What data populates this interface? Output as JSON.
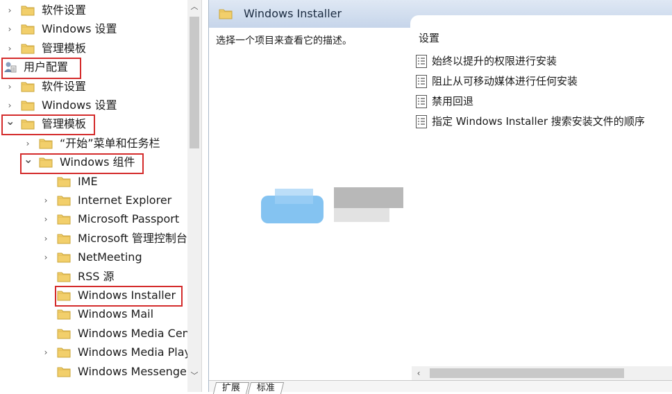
{
  "tree": {
    "items": [
      {
        "label": "软件设置",
        "expander": "collapsed",
        "icon": "folder-icon"
      },
      {
        "label": "Windows 设置",
        "expander": "collapsed",
        "icon": "folder-icon"
      },
      {
        "label": "管理模板",
        "expander": "collapsed",
        "icon": "folder-icon"
      },
      {
        "label": "用户配置",
        "expander": "none",
        "icon": "user-config-icon"
      },
      {
        "label": "软件设置",
        "expander": "collapsed",
        "icon": "folder-icon"
      },
      {
        "label": "Windows 设置",
        "expander": "collapsed",
        "icon": "folder-icon"
      },
      {
        "label": "管理模板",
        "expander": "expanded",
        "icon": "folder-icon"
      },
      {
        "label": "“开始”菜单和任务栏",
        "expander": "collapsed",
        "icon": "folder-icon"
      },
      {
        "label": "Windows 组件",
        "expander": "expanded",
        "icon": "folder-icon"
      },
      {
        "label": "IME",
        "expander": "none",
        "icon": "folder-icon"
      },
      {
        "label": "Internet Explorer",
        "expander": "collapsed",
        "icon": "folder-icon"
      },
      {
        "label": "Microsoft Passport",
        "expander": "collapsed",
        "icon": "folder-icon"
      },
      {
        "label": "Microsoft 管理控制台",
        "expander": "collapsed",
        "icon": "folder-icon"
      },
      {
        "label": "NetMeeting",
        "expander": "collapsed",
        "icon": "folder-icon"
      },
      {
        "label": "RSS 源",
        "expander": "none",
        "icon": "folder-icon"
      },
      {
        "label": "Windows Installer",
        "expander": "none",
        "icon": "folder-icon"
      },
      {
        "label": "Windows Mail",
        "expander": "none",
        "icon": "folder-icon"
      },
      {
        "label": "Windows Media Center",
        "expander": "none",
        "icon": "folder-icon"
      },
      {
        "label": "Windows Media Player",
        "expander": "collapsed",
        "icon": "folder-icon"
      },
      {
        "label": "Windows Messenger",
        "expander": "none",
        "icon": "folder-icon"
      }
    ]
  },
  "right": {
    "header_title": "Windows Installer",
    "description": "选择一个项目来查看它的描述。",
    "settings_header": "设置",
    "settings": [
      "始终以提升的权限进行安装",
      "阻止从可移动媒体进行任何安装",
      "禁用回退",
      "指定 Windows Installer 搜索安装文件的顺序"
    ]
  },
  "bottom_tabs": [
    "扩展",
    "标准"
  ],
  "colors": {
    "highlight_border": "#d42b2b",
    "header_bg": "#c6d5ea",
    "folder_yellow": "#f2cf6b"
  }
}
